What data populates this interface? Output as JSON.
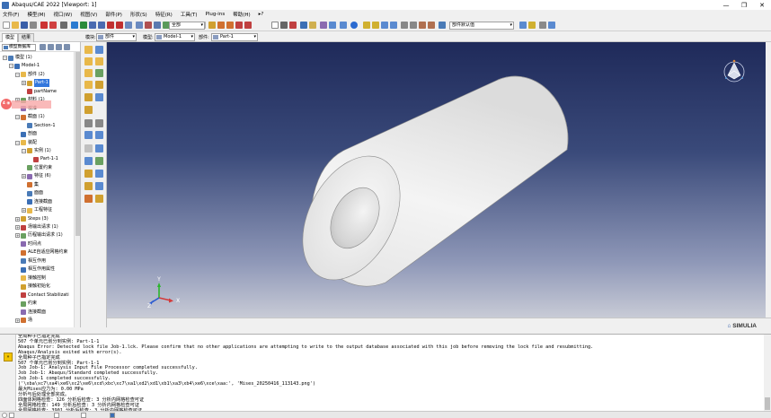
{
  "window": {
    "title": "Abaqus/CAE 2022 [Viewport: 1]",
    "controls": [
      "—",
      "❐",
      "✕"
    ]
  },
  "menu": [
    "文件(F)",
    "模型(M)",
    "视口(W)",
    "视图(V)",
    "部件(P)",
    "形状(S)",
    "特征(R)",
    "工具(T)",
    "Plug-ins",
    "帮助(H)",
    "▸?"
  ],
  "toolbar": {
    "select_all": "全部",
    "render_style": "部件默认值"
  },
  "tabs": [
    "模型",
    "结果"
  ],
  "context": {
    "module_label": "模块:",
    "module_value": "部件",
    "model_label": "模型:",
    "model_value": "Model-1",
    "part_label": "部件:",
    "part_value": "Part-1"
  },
  "tree_manager": "模型数据库",
  "tree": [
    {
      "label": "模型 (1)",
      "exp": "−",
      "indent": 0
    },
    {
      "label": "Model-1",
      "exp": "−",
      "indent": 1
    },
    {
      "label": "部件 (2)",
      "exp": "−",
      "indent": 2
    },
    {
      "label": "Part-1",
      "exp": "+",
      "indent": 3,
      "selected": true
    },
    {
      "label": "partName",
      "exp": "",
      "indent": 3
    },
    {
      "label": "材料 (1)",
      "exp": "+",
      "indent": 2
    },
    {
      "label": "校准",
      "exp": "",
      "indent": 2
    },
    {
      "label": "截面 (1)",
      "exp": "−",
      "indent": 2
    },
    {
      "label": "Section-1",
      "exp": "",
      "indent": 3
    },
    {
      "label": "剖面",
      "exp": "",
      "indent": 2
    },
    {
      "label": "装配",
      "exp": "−",
      "indent": 2
    },
    {
      "label": "实例 (1)",
      "exp": "−",
      "indent": 3
    },
    {
      "label": "Part-1-1",
      "exp": "",
      "indent": 4
    },
    {
      "label": "位置约束",
      "exp": "",
      "indent": 3
    },
    {
      "label": "特征 (6)",
      "exp": "+",
      "indent": 3
    },
    {
      "label": "集",
      "exp": "",
      "indent": 3
    },
    {
      "label": "面面",
      "exp": "",
      "indent": 3
    },
    {
      "label": "连接截面",
      "exp": "",
      "indent": 3
    },
    {
      "label": "工程特征",
      "exp": "+",
      "indent": 3
    },
    {
      "label": "Steps (3)",
      "exp": "+",
      "indent": 2
    },
    {
      "label": "场输出请求 (1)",
      "exp": "+",
      "indent": 2
    },
    {
      "label": "历程输出请求 (1)",
      "exp": "+",
      "indent": 2
    },
    {
      "label": "时间点",
      "exp": "",
      "indent": 2
    },
    {
      "label": "ALE自适应网格约束",
      "exp": "",
      "indent": 2
    },
    {
      "label": "相互作用",
      "exp": "",
      "indent": 2
    },
    {
      "label": "相互作用属性",
      "exp": "",
      "indent": 2
    },
    {
      "label": "接触控制",
      "exp": "",
      "indent": 2
    },
    {
      "label": "接触初始化",
      "exp": "",
      "indent": 2
    },
    {
      "label": "Contact Stabilizati",
      "exp": "",
      "indent": 2
    },
    {
      "label": "约束",
      "exp": "",
      "indent": 2
    },
    {
      "label": "连接截面",
      "exp": "",
      "indent": 2
    },
    {
      "label": "场",
      "exp": "+",
      "indent": 2
    }
  ],
  "recorder_badge": "4 ◉",
  "viewport": {
    "brand": "SIMULIA",
    "axes": {
      "x": "X",
      "y": "Y",
      "z": "Z"
    }
  },
  "messages": [
    "全局种子已指定完成",
    "507 个单元已划分到实例: Part-1-1",
    "Abaqus Error: Detected lock file Job-1.lck. Please confirm that no other applications are attempting to write to the output database associated with this job before removing the lock file and resubmitting.",
    "Abaqus/Analysis exited with error(s).",
    "全局种子已指定完成",
    "507 个单元已划分到实例: Part-1-1",
    "Job Job-1: Analysis Input File Processor completed successfully.",
    "Job Job-1: Abaqus/Standard completed successfully.",
    "Job Job-1 completed successfully.",
    "('\\xba\\xc7\\xa4\\xe6\\xc2\\xe6\\xcd\\xbc\\xc7\\xa1\\xd2\\xd1\\xb1\\xa3\\xb4\\xe6\\xce\\xaa:', 'Mises_20250416_113143.png')",
    "最大Mises应力为: 0.00 MPa",
    "分析与后处理全部完成。",
    "四面体网格检查: 126 分析后检查: 3 分析内网格检查可证",
    "全局网格检查: 149 分析后检查: 3 分析内网格检查可证",
    "全局网格检查: 3901 分析后检查: 3 分析内网格检查可证"
  ]
}
